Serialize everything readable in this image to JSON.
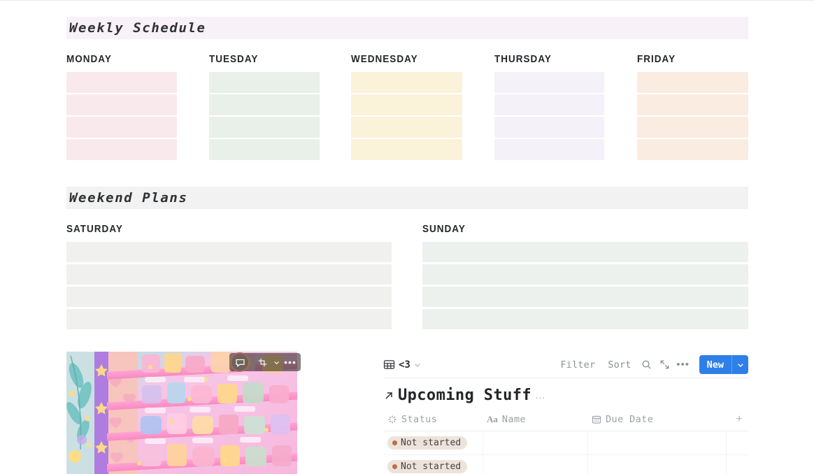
{
  "sections": {
    "weekly": {
      "title": "Weekly Schedule",
      "banner_bg": "#f8f1f7",
      "days": [
        {
          "label": "MONDAY",
          "color": "#fae9ec",
          "slots": 4
        },
        {
          "label": "TUESDAY",
          "color": "#e9f0ea",
          "slots": 4
        },
        {
          "label": "WEDNESDAY",
          "color": "#faf2d9",
          "slots": 4
        },
        {
          "label": "THURSDAY",
          "color": "#f4f1f8",
          "slots": 4
        },
        {
          "label": "FRIDAY",
          "color": "#faece0",
          "slots": 4
        }
      ]
    },
    "weekend": {
      "title": "Weekend Plans",
      "banner_bg": "#f2f2f2",
      "days": [
        {
          "label": "SATURDAY",
          "color": "#f0f0ef",
          "slots": 4
        },
        {
          "label": "SUNDAY",
          "color": "#ecf1ed",
          "slots": 4
        }
      ]
    }
  },
  "illustration": {
    "alt_name": "kawaii-candy-shop-illustration",
    "toolbar": {
      "comment_icon": "comment-icon",
      "crop_icon": "image-crop-icon",
      "caret_icon": "chevron-down-icon",
      "more_icon": "more-options-icon",
      "more_glyph": "•••"
    }
  },
  "database": {
    "view_name": "<3",
    "view_icon": "table-grid-icon",
    "view_caret": "chevron-down-icon",
    "toolbar": {
      "filter_label": "Filter",
      "sort_label": "Sort",
      "search_icon": "search-icon",
      "expand_icon": "expand-collapse-icon",
      "more_icon": "more-options-icon",
      "more_glyph": "•••",
      "new_label": "New",
      "new_caret": "chevron-down-icon",
      "new_color": "#2f7fe8"
    },
    "title": "Upcoming Stuff",
    "title_link_icon": "arrow-up-right-icon",
    "title_more_glyph": "…",
    "columns": [
      {
        "label": "Status",
        "icon": "status-spinner-icon"
      },
      {
        "label": "Name",
        "icon": "title-aa-icon"
      },
      {
        "label": "Due Date",
        "icon": "calendar-icon"
      }
    ],
    "add_column_glyph": "+",
    "rows": [
      {
        "status": "Not started",
        "name": "",
        "due_date": ""
      },
      {
        "status": "Not started",
        "name": "",
        "due_date": ""
      }
    ],
    "status_colors": {
      "pill_bg": "#eee3db",
      "dot": "#b5714d"
    }
  }
}
